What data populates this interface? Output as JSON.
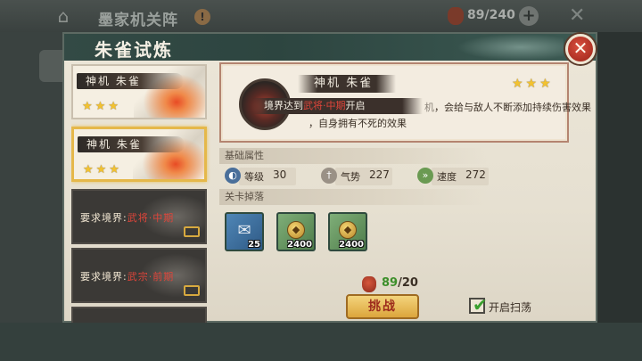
{
  "background": {
    "title": "墨家机关阵",
    "info_badge": "!",
    "stamina": "89/240",
    "plus": "+",
    "close": "✕",
    "home": "⌂"
  },
  "modal": {
    "title": "朱雀试炼",
    "close": "✕"
  },
  "stages": [
    {
      "name": "神机 朱雀",
      "stars": "★★★",
      "state": "cleared"
    },
    {
      "name": "神机 朱雀",
      "stars": "★★★",
      "state": "selected"
    },
    {
      "lock_prefix": "要求境界:",
      "lock_req": "武将·中期",
      "state": "locked"
    },
    {
      "lock_prefix": "要求境界:",
      "lock_req": "武宗·前期",
      "state": "locked"
    }
  ],
  "boss": {
    "name": "神机 朱雀",
    "stars": "★★★",
    "unlock_prefix": "境界达到",
    "unlock_req": "武将·中期",
    "unlock_suffix": "开启",
    "desc_faded": "机",
    "desc_line1": "，会给与敌人不断添加持续伤害效果",
    "desc_line2": "，自身拥有不死的效果"
  },
  "sections": {
    "base_attrs": "基础属性",
    "drops": "关卡掉落"
  },
  "stats": [
    {
      "label": "等级",
      "value": "30",
      "icon": "level-icon"
    },
    {
      "label": "气势",
      "value": "227",
      "icon": "momentum-icon"
    },
    {
      "label": "速度",
      "value": "272",
      "icon": "speed-icon"
    }
  ],
  "drops": [
    {
      "icon": "scroll-icon",
      "qty": "25",
      "color": "#3d6f9a"
    },
    {
      "icon": "coin-icon",
      "qty": "2400",
      "color": "#6a9a66"
    },
    {
      "icon": "coin-icon",
      "qty": "2400",
      "color": "#6a9a66"
    }
  ],
  "cost": {
    "current": "89",
    "required": "/20"
  },
  "buttons": {
    "challenge": "挑战",
    "sweep_label": "开启扫荡",
    "sweep_checked": true
  }
}
